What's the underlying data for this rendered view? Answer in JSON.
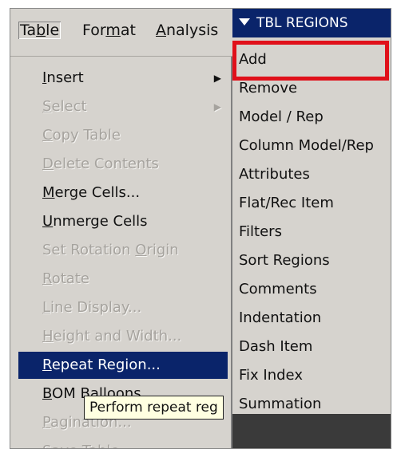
{
  "menubar": {
    "items": [
      {
        "pre": "Ta",
        "u": "b",
        "post": "le"
      },
      {
        "pre": "For",
        "u": "m",
        "post": "at"
      },
      {
        "pre": "",
        "u": "A",
        "post": "nalysis"
      }
    ]
  },
  "table_menu": {
    "items": [
      {
        "pre": "",
        "u": "I",
        "post": "nsert",
        "disabled": false,
        "submenu": true
      },
      {
        "pre": "",
        "u": "S",
        "post": "elect",
        "disabled": true,
        "submenu": true
      },
      {
        "pre": "",
        "u": "C",
        "post": "opy Table",
        "disabled": true,
        "submenu": false
      },
      {
        "pre": "",
        "u": "D",
        "post": "elete Contents",
        "disabled": true,
        "submenu": false
      },
      {
        "pre": "",
        "u": "M",
        "post": "erge Cells...",
        "disabled": false,
        "submenu": false
      },
      {
        "pre": "",
        "u": "U",
        "post": "nmerge Cells",
        "disabled": false,
        "submenu": false
      },
      {
        "pre": "Set Rotation ",
        "u": "O",
        "post": "rigin",
        "disabled": true,
        "submenu": false
      },
      {
        "pre": "",
        "u": "R",
        "post": "otate",
        "disabled": true,
        "submenu": false
      },
      {
        "pre": "",
        "u": "L",
        "post": "ine Display...",
        "disabled": true,
        "submenu": false
      },
      {
        "pre": "",
        "u": "H",
        "post": "eight and Width...",
        "disabled": true,
        "submenu": false
      },
      {
        "pre": "",
        "u": "R",
        "post": "epeat Region...",
        "disabled": false,
        "submenu": false,
        "selected": true
      },
      {
        "pre": "",
        "u": "B",
        "post": "OM Balloons...",
        "disabled": false,
        "submenu": false
      },
      {
        "pre": "",
        "u": "P",
        "post": "agination...",
        "disabled": true,
        "submenu": false
      },
      {
        "pre": "Sa",
        "u": "v",
        "post": "e Table",
        "disabled": true,
        "submenu": true
      }
    ],
    "submenu_arrow": "▶"
  },
  "tooltip": {
    "text": "Perform repeat reg"
  },
  "tbl_regions": {
    "header": "TBL REGIONS",
    "items": [
      "Add",
      "Remove",
      "Model / Rep",
      "Column Model/Rep",
      "Attributes",
      "Flat/Rec Item",
      "Filters",
      "Sort Regions",
      "Comments",
      "Indentation",
      "Dash Item",
      "Fix Index",
      "Summation"
    ],
    "highlight_color": "#e0101a"
  },
  "colors": {
    "menu_bg": "#d6d3ce",
    "selection": "#0a246a",
    "disabled_text": "#a6a39e"
  }
}
